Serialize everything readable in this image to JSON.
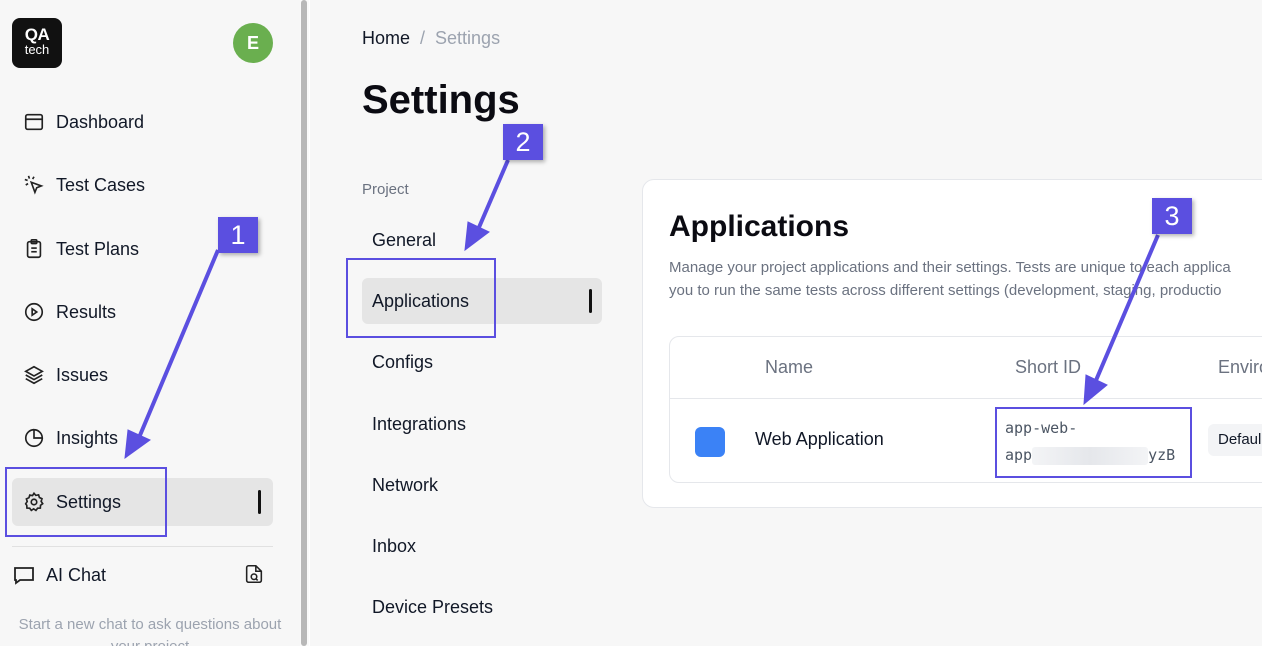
{
  "sidebar": {
    "logo": {
      "line1": "QA",
      "line2": "tech"
    },
    "avatar_initial": "E",
    "items": [
      {
        "label": "Dashboard",
        "icon": "calendar-icon"
      },
      {
        "label": "Test Cases",
        "icon": "cursor-click-icon"
      },
      {
        "label": "Test Plans",
        "icon": "clipboard-icon"
      },
      {
        "label": "Results",
        "icon": "play-circle-icon"
      },
      {
        "label": "Issues",
        "icon": "layers-icon"
      },
      {
        "label": "Insights",
        "icon": "pie-chart-icon"
      },
      {
        "label": "Settings",
        "icon": "gear-icon",
        "active": true
      }
    ],
    "ai_chat": {
      "label": "AI Chat",
      "hint": "Start a new chat to ask questions about your project"
    }
  },
  "breadcrumb": {
    "home": "Home",
    "separator": "/",
    "current": "Settings"
  },
  "page_title": "Settings",
  "settings_nav": {
    "section_label": "Project",
    "items": [
      "General",
      "Applications",
      "Configs",
      "Integrations",
      "Network",
      "Inbox",
      "Device Presets"
    ],
    "active": "Applications"
  },
  "applications": {
    "title": "Applications",
    "description_line1": "Manage your project applications and their settings. Tests are unique to each applica",
    "description_line2": "you to run the same tests across different settings (development, staging, productio",
    "columns": {
      "name": "Name",
      "short_id": "Short ID",
      "environment": "Enviro"
    },
    "rows": [
      {
        "name": "Web Application",
        "short_id_line1": "app-web-",
        "short_id_prefix": "app",
        "short_id_suffix": "yzB",
        "environment": "Defaul",
        "color": "#3b82f6"
      }
    ]
  },
  "annotations": {
    "accent": "#5b4fe0",
    "labels": [
      "1",
      "2",
      "3"
    ]
  }
}
